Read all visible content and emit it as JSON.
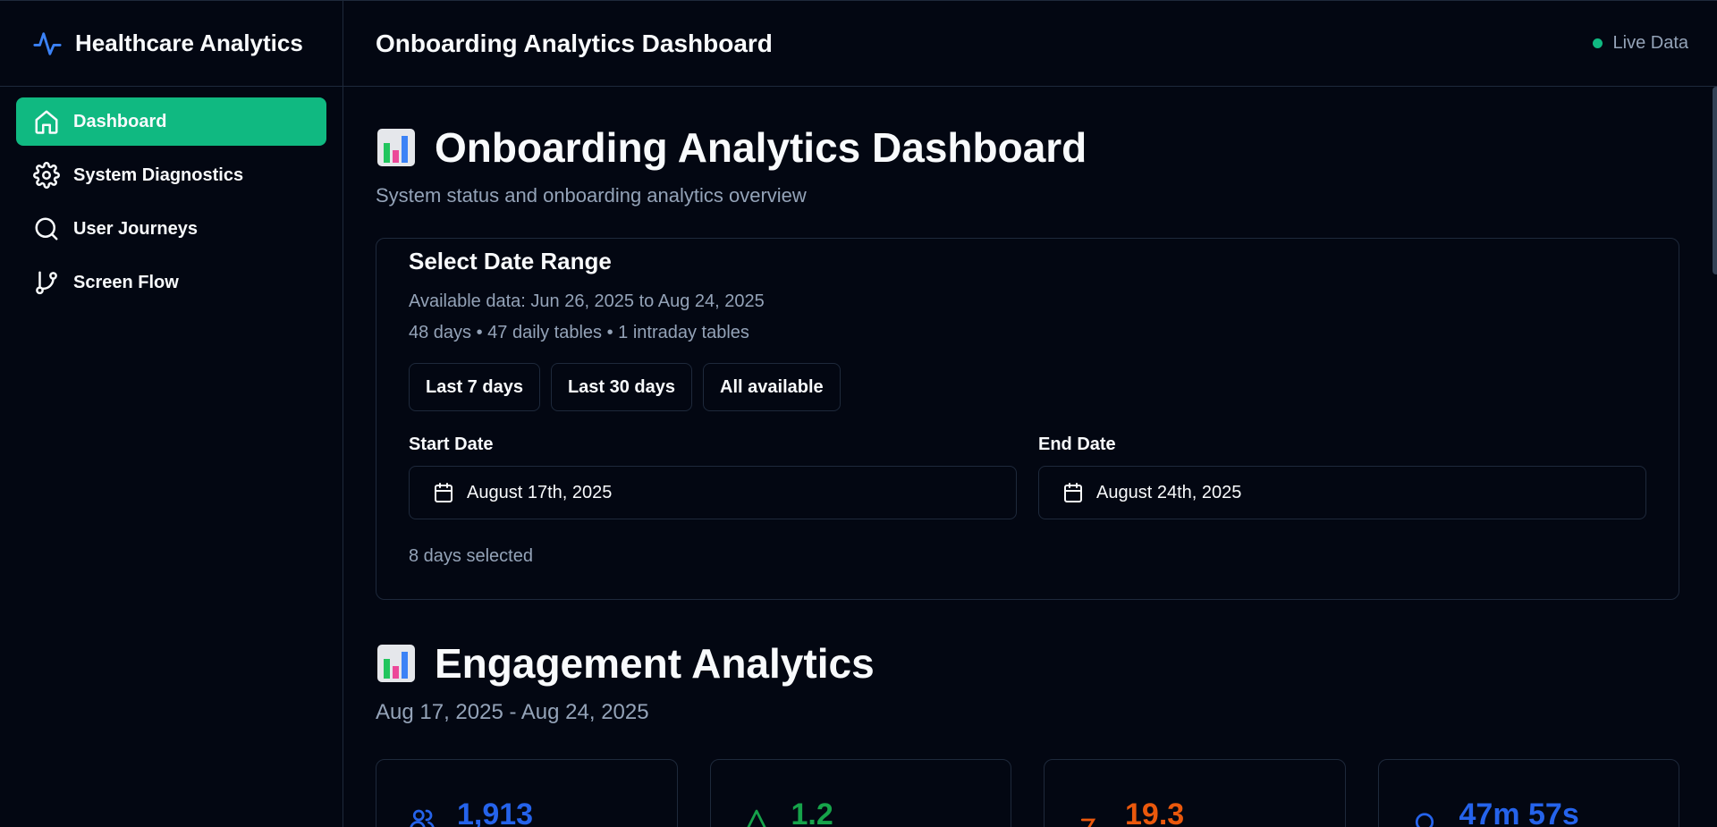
{
  "sidebar": {
    "brand": "Healthcare Analytics",
    "items": [
      {
        "label": "Dashboard",
        "icon": "home-icon",
        "active": true
      },
      {
        "label": "System Diagnostics",
        "icon": "gear-icon"
      },
      {
        "label": "User Journeys",
        "icon": "search-icon"
      },
      {
        "label": "Screen Flow",
        "icon": "git-branch-icon"
      }
    ]
  },
  "topbar": {
    "title": "Onboarding Analytics Dashboard",
    "status": "Live Data"
  },
  "main": {
    "heading": "Onboarding Analytics Dashboard",
    "subtitle": "System status and onboarding analytics overview",
    "date_card": {
      "title": "Select Date Range",
      "available": "Available data: Jun 26, 2025 to Aug 24, 2025",
      "summary": "48 days • 47 daily tables • 1 intraday tables",
      "presets": [
        "Last 7 days",
        "Last 30 days",
        "All available"
      ],
      "start_label": "Start Date",
      "start_value": "August 17th, 2025",
      "end_label": "End Date",
      "end_value": "August 24th, 2025",
      "selected": "8 days selected"
    },
    "engagement": {
      "heading": "Engagement Analytics",
      "range": "Aug 17, 2025 - Aug 24, 2025",
      "stats": [
        {
          "value": "1,913",
          "color": "#2563eb",
          "icon": "users-icon"
        },
        {
          "value": "1.2",
          "color": "#16a34a",
          "icon": "activity-icon"
        },
        {
          "value": "19.3",
          "color": "#ea580c",
          "icon": "clock-icon"
        },
        {
          "value": "47m 57s",
          "color": "#2563eb",
          "icon": "timer-icon"
        }
      ]
    }
  },
  "colors": {
    "accent": "#10b981",
    "background": "#030712",
    "border": "#1e293b",
    "muted": "#94a3b8"
  }
}
